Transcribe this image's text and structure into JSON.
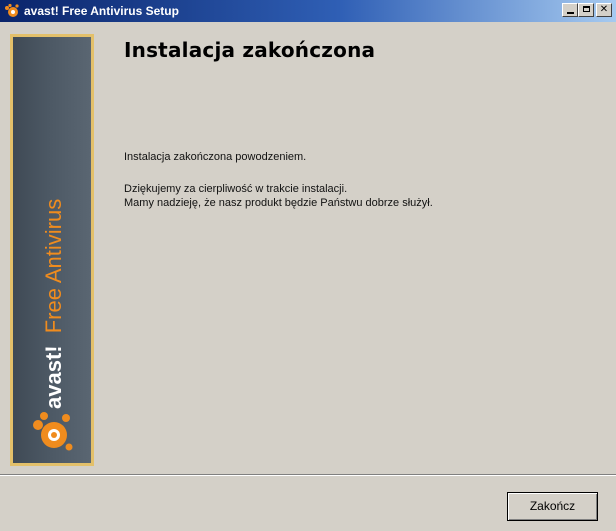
{
  "window": {
    "title": "avast! Free Antivirus Setup",
    "controls": {
      "minimize": "minimize",
      "maximize": "maximize",
      "close": "close"
    }
  },
  "banner": {
    "brand": "avast!",
    "product": "Free Antivirus",
    "colors": {
      "frame": "#e3c06a",
      "panel": "#4c5864",
      "accent": "#f08c1e"
    }
  },
  "page": {
    "title": "Instalacja zakończona",
    "message_1": "Instalacja zakończona powodzeniem.",
    "message_2": "Dziękujemy za cierpliwość w trakcie instalacji.",
    "message_3": "Mamy nadzieję, że nasz produkt będzie Państwu dobrze służył."
  },
  "footer": {
    "finish_label": "Zakończ"
  }
}
